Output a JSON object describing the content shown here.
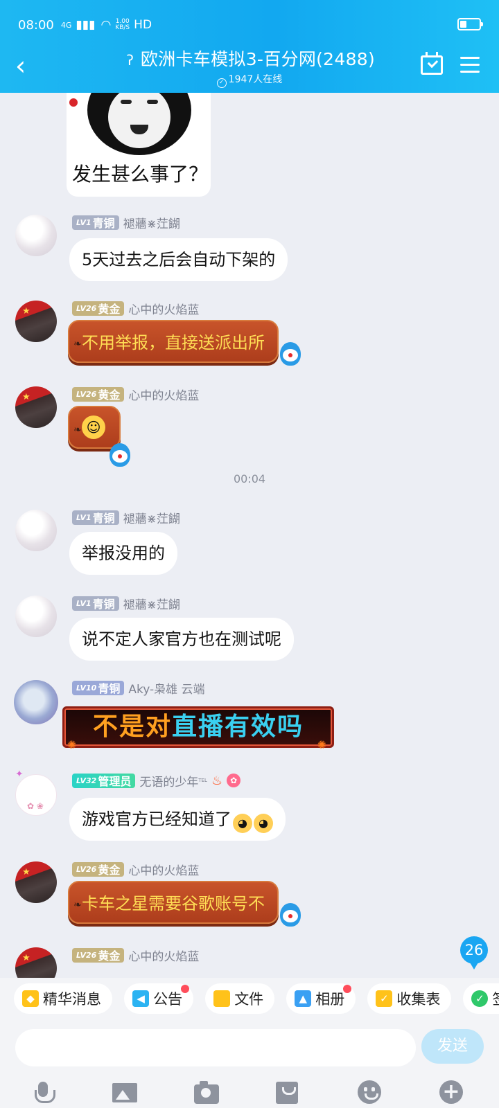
{
  "status_bar": {
    "time": "08:00",
    "signal": "4G",
    "net_speed_value": "1.00",
    "net_speed_unit": "KB/S",
    "hd": "HD"
  },
  "header": {
    "title": "欧洲卡车模拟3-百分网(2488)",
    "online": "1947人在线"
  },
  "messages": {
    "sticker_caption": "发生甚么事了？",
    "m1": {
      "level": "LV1",
      "rank": "青铜",
      "name": "褪蘠⋇茳餬",
      "text": "5天过去之后会自动下架的"
    },
    "m2": {
      "level": "LV26",
      "rank": "黄金",
      "name": "心中的火焰蓝",
      "text": "不用举报，直接送派出所"
    },
    "m3": {
      "level": "LV26",
      "rank": "黄金",
      "name": "心中的火焰蓝"
    },
    "time_divider": "00:04",
    "m4": {
      "level": "LV1",
      "rank": "青铜",
      "name": "褪蘠⋇茳餬",
      "text": "举报没用的"
    },
    "m5": {
      "level": "LV1",
      "rank": "青铜",
      "name": "褪蘠⋇茳餬",
      "text": "说不定人家官方也在测试呢"
    },
    "m6": {
      "level": "LV10",
      "rank": "青铜",
      "name": "Aky-枭雄 云端",
      "text_a": "不是对",
      "text_b": "直播有效吗"
    },
    "m7": {
      "level": "LV32",
      "rank": "管理员",
      "name": "无语的少年",
      "tel": "TEL",
      "text": "游戏官方已经知道了"
    },
    "m8": {
      "level": "LV26",
      "rank": "黄金",
      "name": "心中的火焰蓝",
      "text": "卡车之星需要谷歌账号不"
    },
    "m9": {
      "level": "LV26",
      "rank": "黄金",
      "name": "心中的火焰蓝"
    }
  },
  "unread_count": "26",
  "toolbar_chips": [
    "精华消息",
    "公告",
    "文件",
    "相册",
    "收集表",
    "签到"
  ],
  "input": {
    "placeholder": "",
    "send_label": "发送"
  },
  "colors": {
    "header": "#12a8f0",
    "chat_bg": "#eceef4",
    "accent": "#1aa6f2",
    "red_bubble": "#b84520",
    "red_bubble_text": "#ffde55",
    "badge_dot": "#ff4d5b"
  },
  "icons": [
    "back-arrow-icon",
    "ear-icon",
    "check-circle-icon",
    "calendar-check-icon",
    "menu-icon",
    "mic-icon",
    "image-icon",
    "camera-icon",
    "red-packet-icon",
    "emoji-icon",
    "plus-icon"
  ]
}
